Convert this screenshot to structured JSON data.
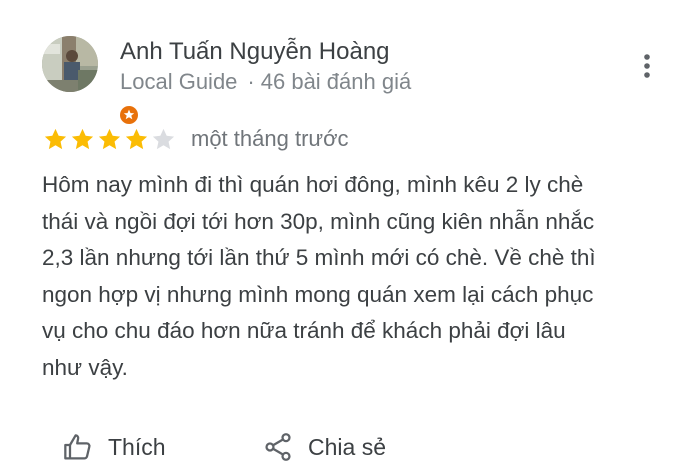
{
  "review": {
    "author": {
      "name": "Anh Tuấn Nguyễn Hoàng",
      "badge": "Local Guide",
      "separator": "·",
      "review_count": "46 bài đánh giá"
    },
    "rating": {
      "value": 4,
      "max": 5,
      "filled_color": "#fbbc04",
      "empty_color": "#dadce0"
    },
    "date": "một tháng trước",
    "text_lines": [
      "Hôm nay mình đi thì quán hơi đông, mình kêu 2 ly chè",
      "thái và ngồi đợi tới hơn 30p, mình cũng kiên nhẫn nhắc",
      "2,3 lần nhưng tới lần thứ 5 mình mới có chè. Về chè thì",
      "ngon hợp vị nhưng mình mong quán xem lại cách phục",
      "vụ cho chu đáo hơn nữa tránh để khách phải đợi lâu",
      "như vậy."
    ],
    "actions": {
      "like_label": "Thích",
      "share_label": "Chia sẻ"
    }
  },
  "icons": {
    "more": "more-vert-icon",
    "like": "thumb-up-icon",
    "share": "share-icon",
    "badge": "local-guide-star-icon"
  },
  "colors": {
    "badge_orange": "#e8710a",
    "icon_gray": "#5f6368"
  }
}
